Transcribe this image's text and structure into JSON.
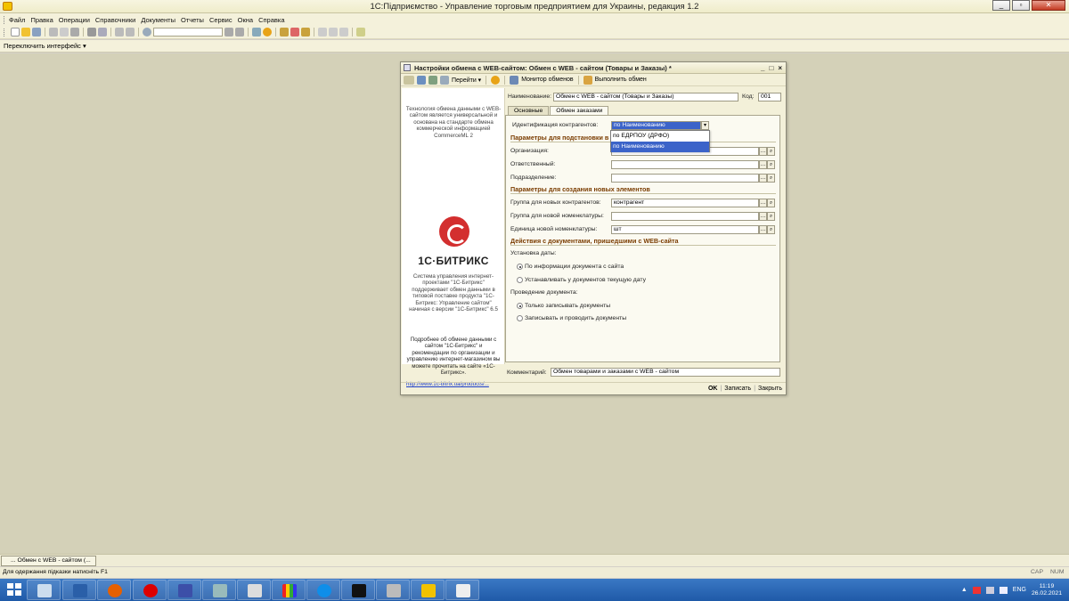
{
  "app": {
    "title": "1С:Підприємство - Управление торговым предприятием для Украины, редакция 1.2",
    "window_controls": [
      "_",
      "▫",
      "✕"
    ]
  },
  "menu": [
    "Файл",
    "Правка",
    "Операции",
    "Справочники",
    "Документы",
    "Отчеты",
    "Сервис",
    "Окна",
    "Справка"
  ],
  "interface_switch": "Переключить интерфейс ▾",
  "dialog": {
    "title": "Настройки обмена с WEB-сайтом: Обмен с WEB - сайтом (Товары и Заказы) *",
    "toolbar": {
      "goto": "Перейти ▾",
      "monitor": "Монитор обменов",
      "execute": "Выполнить обмен"
    },
    "name_label": "Наименование:",
    "name_value": "Обмен с WEB - сайтом (Товары и Заказы)",
    "code_label": "Код:",
    "code_value": "001",
    "tabs": [
      "Основные",
      "Обмен заказами"
    ],
    "identification_label": "Идентификация контрагентов:",
    "identification_value": "по Наименованию",
    "dropdown_options": [
      "по ЕДРПОУ (ДРФО)",
      "по Наименованию"
    ],
    "section_substitution": "Параметры для подстановки в",
    "org_label": "Организация:",
    "responsible_label": "Ответственный:",
    "department_label": "Подразделение:",
    "section_new": "Параметры для создания новых элементов",
    "group_contr_label": "Группа для новых контрагентов:",
    "group_contr_value": "контрагент",
    "group_nom_label": "Группа для новой номенклатуры:",
    "unit_label": "Единица новой номенклатуры:",
    "unit_value": "шт",
    "section_docs": "Действия с документами, пришедшими с WEB-сайта",
    "date_setting_label": "Установка даты:",
    "date_opt1": "По информации документа с сайта",
    "date_opt2": "Устанавливать у документов текущую дату",
    "posting_label": "Проведение документа:",
    "post_opt1": "Только записывать документы",
    "post_opt2": "Записывать и проводить документы",
    "comment_label": "Комментарий:",
    "comment_value": "Обмен товарами и заказами с WEB - сайтом",
    "footer": {
      "ok": "OK",
      "save": "Записать",
      "close": "Закрыть",
      "sep": "|"
    }
  },
  "sidebar": {
    "intro": "Технология обмена данными с WEB-сайтом является универсальной и основана на стандарте обмена коммерческой информацией CommerceML 2",
    "brand": "1С·БИТРИКС",
    "system": "Система управления интернет-проектами \"1С-Битрикс\" поддерживает обмен данными в типовой поставке продукта \"1С-Битрикс: Управление сайтом\" начиная с версии \"1С-Битрикс\" 6.5",
    "details": "Подробнее об обмене данными с сайтом \"1С-Битрикс\" и рекомендации по организации и управлению интернет-магазином вы можете прочитать на сайте «1С-Битрикс».",
    "link": "http://www.1c-bitrix.ua/products/..."
  },
  "taskpane": {
    "item": "... Обмен с WEB - сайтом (..."
  },
  "status": {
    "hint": "Для одержання підказки натисніть F1",
    "cap": "CAP",
    "num": "NUM"
  },
  "taskbar": {
    "lang": "ENG",
    "time": "11:19",
    "date": "26.02.2021"
  },
  "colors": {
    "accent_section": "#7a3c00",
    "selection": "#3b63c9",
    "taskbar": "#2a68b8",
    "bitrix": "#d32f2f"
  }
}
